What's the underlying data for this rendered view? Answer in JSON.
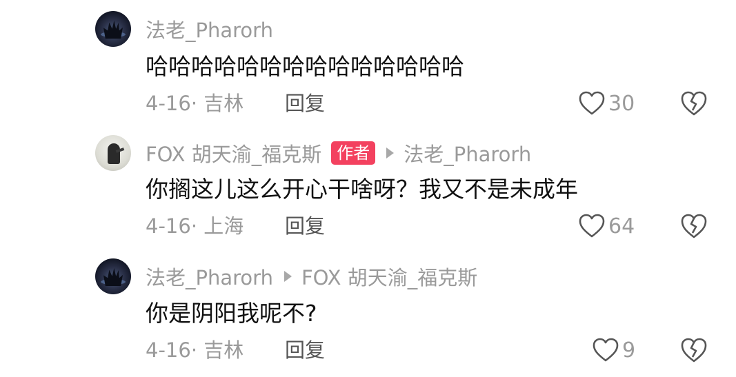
{
  "comments": [
    {
      "avatar": "dark-figure-avatar",
      "username": "法老_Pharorh",
      "is_author": false,
      "reply_to": "",
      "text": "哈哈哈哈哈哈哈哈哈哈哈哈哈哈",
      "date_location": "4-16· 吉林",
      "reply_label": "回复",
      "likes": "30"
    },
    {
      "avatar": "light-figure-avatar",
      "username": "FOX 胡天渝_福克斯",
      "is_author": true,
      "author_label": "作者",
      "reply_to": "法老_Pharorh",
      "text": "你搁这儿这么开心干啥呀？我又不是未成年",
      "date_location": "4-16· 上海",
      "reply_label": "回复",
      "likes": "64"
    },
    {
      "avatar": "dark-figure-avatar",
      "username": "法老_Pharorh",
      "is_author": false,
      "reply_to": "FOX 胡天渝_福克斯",
      "text": "你是阴阳我呢不?",
      "date_location": "4-16· 吉林",
      "reply_label": "回复",
      "likes": "9"
    }
  ],
  "icons": {
    "like": "heart-outline-icon",
    "dislike": "broken-heart-icon"
  },
  "colors": {
    "author_badge": "#f3415f",
    "meta_text": "#9a9a9a",
    "body_text": "#111111"
  }
}
